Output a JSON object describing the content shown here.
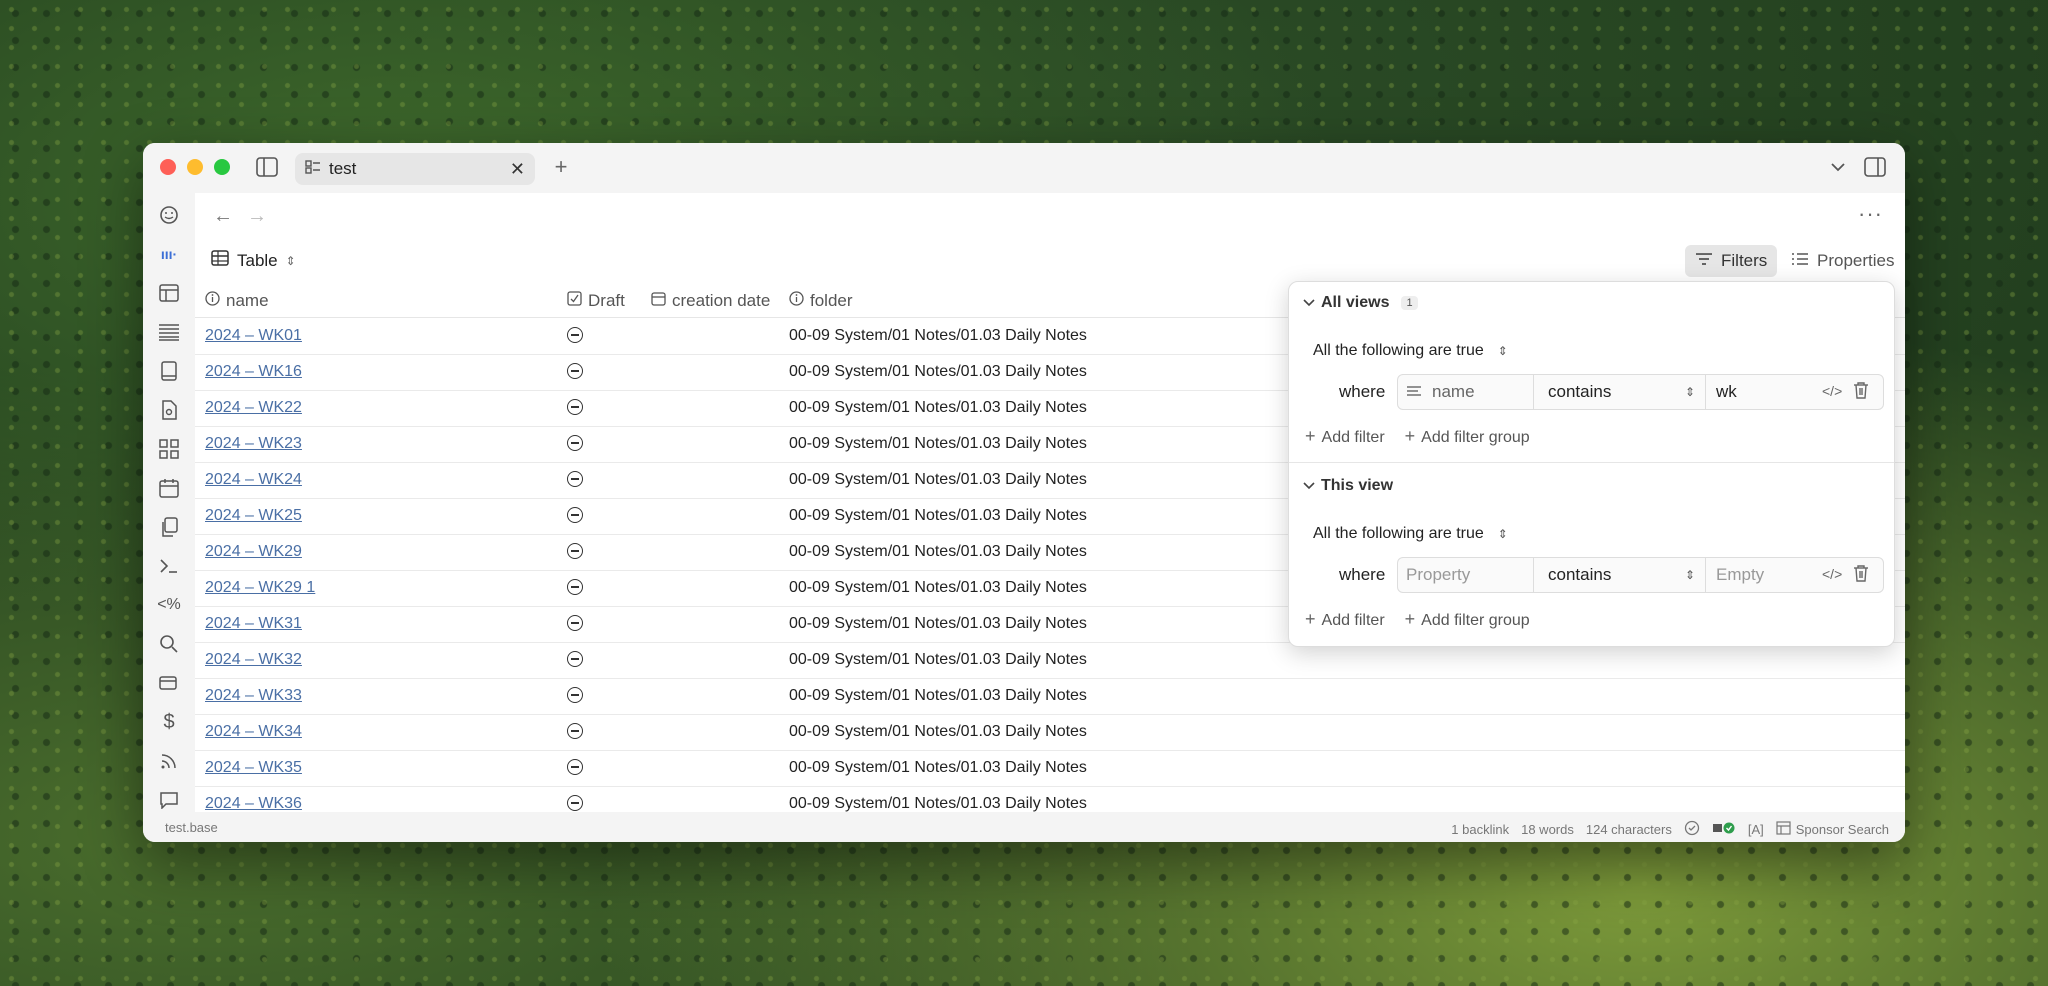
{
  "tab": {
    "title": "test"
  },
  "view": {
    "name": "Table"
  },
  "toolbar": {
    "filters_label": "Filters",
    "properties_label": "Properties"
  },
  "columns": [
    {
      "label": "name",
      "icon": "info-icon"
    },
    {
      "label": "Draft",
      "icon": "checkbox-icon"
    },
    {
      "label": "creation date",
      "icon": "calendar-icon"
    },
    {
      "label": "folder",
      "icon": "info-icon"
    }
  ],
  "rows": [
    {
      "name": "2024 – WK01",
      "folder": "00-09 System/01 Notes/01.03 Daily Notes"
    },
    {
      "name": "2024 – WK16",
      "folder": "00-09 System/01 Notes/01.03 Daily Notes"
    },
    {
      "name": "2024 – WK22",
      "folder": "00-09 System/01 Notes/01.03 Daily Notes"
    },
    {
      "name": "2024 – WK23",
      "folder": "00-09 System/01 Notes/01.03 Daily Notes"
    },
    {
      "name": "2024 – WK24",
      "folder": "00-09 System/01 Notes/01.03 Daily Notes"
    },
    {
      "name": "2024 – WK25",
      "folder": "00-09 System/01 Notes/01.03 Daily Notes"
    },
    {
      "name": "2024 – WK29",
      "folder": "00-09 System/01 Notes/01.03 Daily Notes"
    },
    {
      "name": "2024 – WK29 1",
      "folder": "00-09 System/01 Notes/01.03 Daily Notes"
    },
    {
      "name": "2024 – WK31",
      "folder": "00-09 System/01 Notes/01.03 Daily Notes"
    },
    {
      "name": "2024 – WK32",
      "folder": "00-09 System/01 Notes/01.03 Daily Notes"
    },
    {
      "name": "2024 – WK33",
      "folder": "00-09 System/01 Notes/01.03 Daily Notes"
    },
    {
      "name": "2024 – WK34",
      "folder": "00-09 System/01 Notes/01.03 Daily Notes"
    },
    {
      "name": "2024 – WK35",
      "folder": "00-09 System/01 Notes/01.03 Daily Notes"
    },
    {
      "name": "2024 – WK36",
      "folder": "00-09 System/01 Notes/01.03 Daily Notes"
    }
  ],
  "filters": {
    "all_views": {
      "title": "All views",
      "count": "1",
      "conjunction": "All the following are true",
      "where_label": "where",
      "condition": {
        "property": "name",
        "operator": "contains",
        "value": "wk"
      },
      "add_filter": "Add filter",
      "add_filter_group": "Add filter group"
    },
    "this_view": {
      "title": "This view",
      "conjunction": "All the following are true",
      "where_label": "where",
      "condition": {
        "property_placeholder": "Property",
        "operator": "contains",
        "value_placeholder": "Empty"
      },
      "add_filter": "Add filter",
      "add_filter_group": "Add filter group"
    }
  },
  "status": {
    "file": "test.base",
    "backlinks": "1 backlink",
    "words": "18 words",
    "characters": "124 characters",
    "mode": "[A]",
    "sponsor": "Sponsor Search"
  }
}
